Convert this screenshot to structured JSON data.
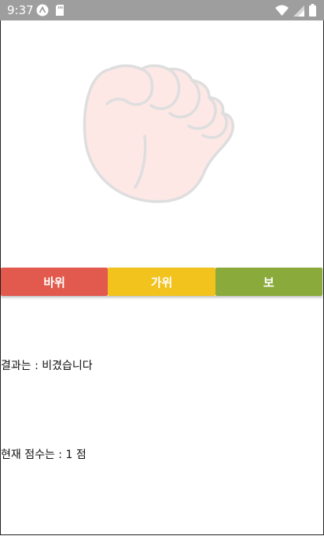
{
  "status_bar": {
    "time": "9:37",
    "left_icons": [
      "app-logo-icon",
      "sd-card-icon"
    ],
    "right_icons": [
      "wifi-icon",
      "signal-icon",
      "battery-icon"
    ]
  },
  "image": {
    "icon": "rock-fist-icon"
  },
  "buttons": {
    "rock": "바위",
    "scissors": "가위",
    "paper": "보"
  },
  "colors": {
    "rock": "#e25a4e",
    "scissors": "#f2c21d",
    "paper": "#8aab3c"
  },
  "result": {
    "text": "결과는 : 비겼습니다"
  },
  "score": {
    "text": "현재 점수는 : 1 점"
  }
}
